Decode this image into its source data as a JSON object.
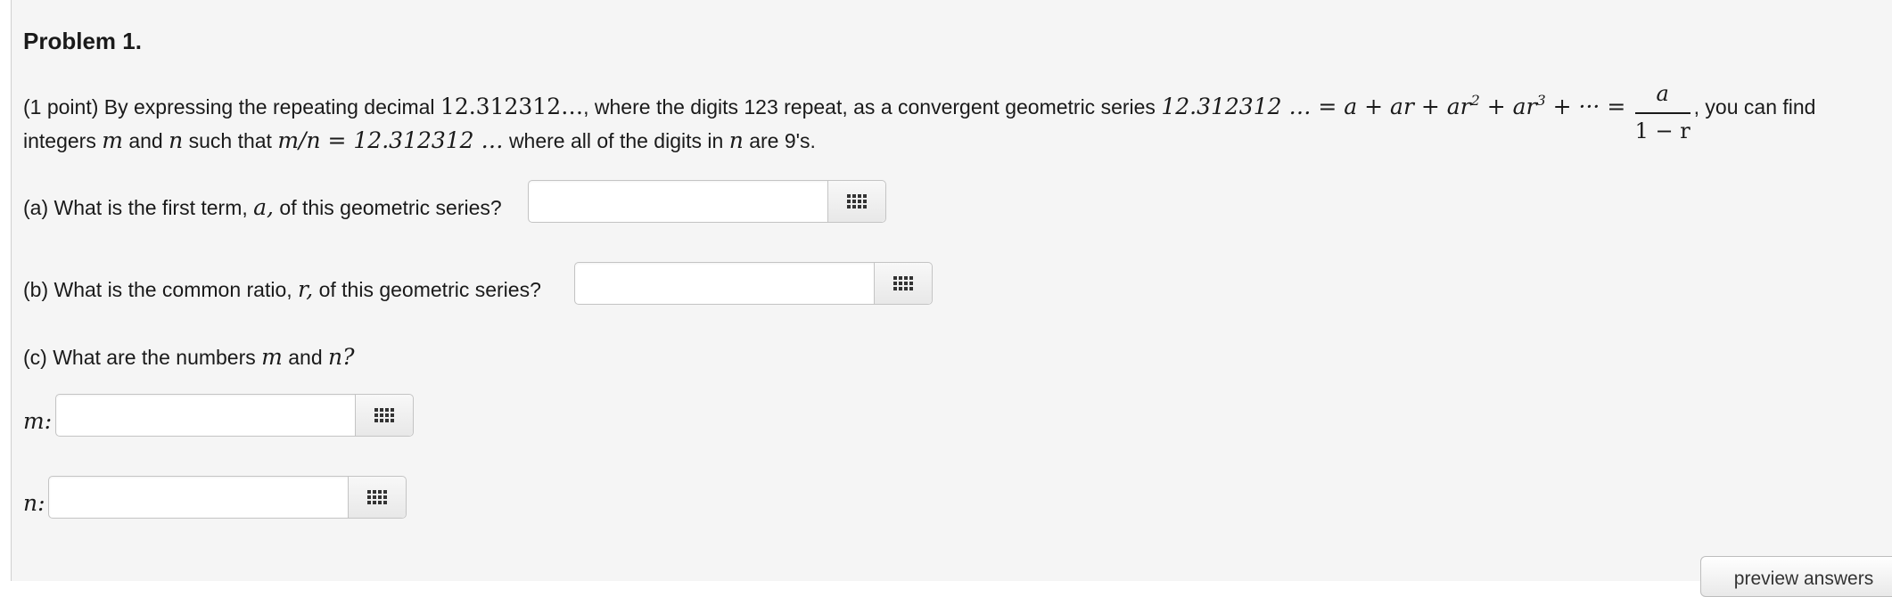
{
  "problem": {
    "title": "Problem 1.",
    "intro": {
      "points": "(1 point) By expressing the repeating decimal",
      "decimal": "12.312312",
      "ellipsis": "…",
      "after_decimal": ", where the digits 123 repeat, as a convergent geometric series",
      "series_lhs": "12.312312 … = a + ar + ar",
      "exp2": "2",
      "series_mid": " + ar",
      "exp3": "3",
      "series_end": " + ··· =",
      "frac_num": "a",
      "frac_den": "1 − r",
      "after_frac": ", you can find",
      "line2_start": "integers",
      "var_m": "m",
      "and": "and",
      "var_n": "n",
      "line2_mid": "such that",
      "ratio_expr": "m/n = 12.312312 …",
      "line2_end": "where all of the digits in",
      "line2_tail": "are 9's."
    },
    "part_a": {
      "label_pre": "(a) What is the first term,",
      "var": "a,",
      "label_post": "of this geometric series?",
      "value": ""
    },
    "part_b": {
      "label_pre": "(b) What is the common ratio,",
      "var": "r,",
      "label_post": "of this geometric series?",
      "value": ""
    },
    "part_c": {
      "label_pre": "(c) What are the numbers",
      "var_m": "m",
      "and": "and",
      "var_n": "n?"
    },
    "field_m": {
      "label": "m:",
      "value": ""
    },
    "field_n": {
      "label": "n:",
      "value": ""
    },
    "keyboard_icon": "grid-keypad-icon",
    "preview_button": "preview answers"
  }
}
